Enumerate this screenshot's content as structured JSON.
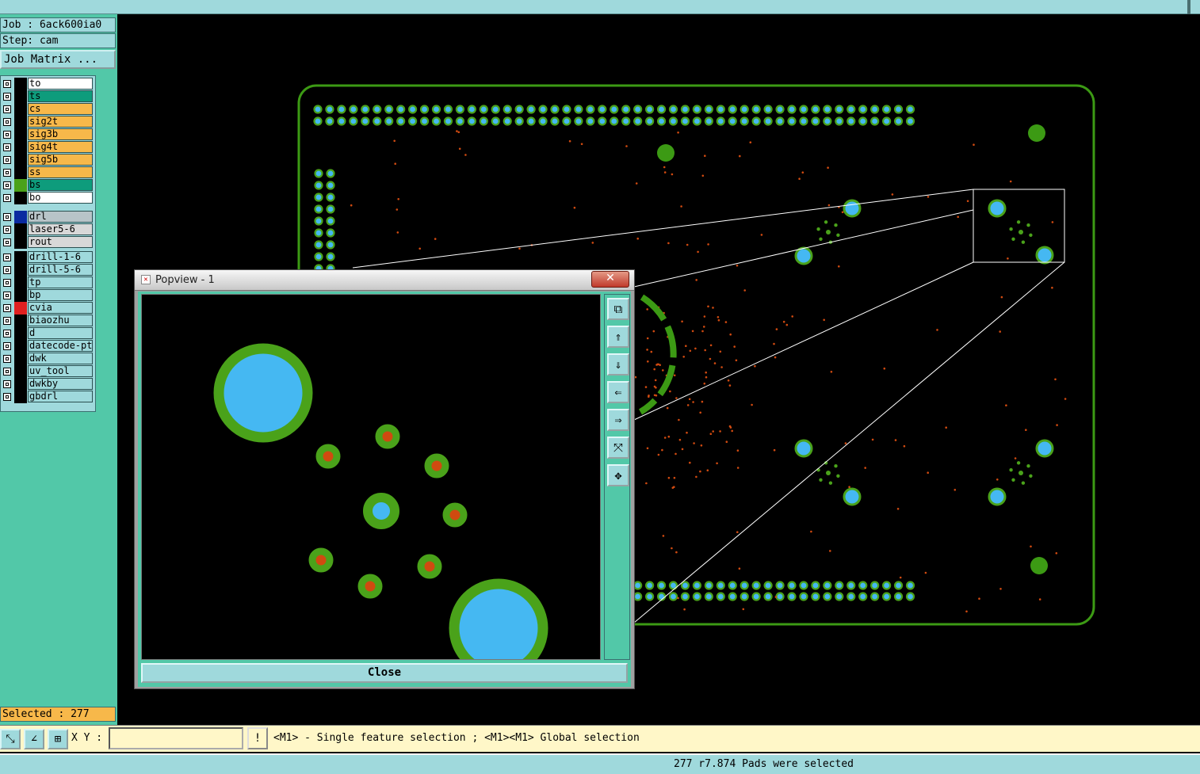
{
  "header": {
    "job": "Job : 6ack600ia0",
    "step": "Step: cam",
    "job_matrix_label": "Job Matrix ..."
  },
  "layers_group1": [
    {
      "name": "to",
      "color": "#ffffff",
      "swatch": "#000000"
    },
    {
      "name": "ts",
      "color": "#0e9c7c",
      "swatch": "#000000"
    },
    {
      "name": "cs",
      "color": "#f7b84a",
      "swatch": "#000000"
    },
    {
      "name": "sig2t",
      "color": "#f7b84a",
      "swatch": "#000000"
    },
    {
      "name": "sig3b",
      "color": "#f7b84a",
      "swatch": "#000000"
    },
    {
      "name": "sig4t",
      "color": "#f7b84a",
      "swatch": "#000000"
    },
    {
      "name": "sig5b",
      "color": "#f7b84a",
      "swatch": "#000000"
    },
    {
      "name": "ss",
      "color": "#f7b84a",
      "swatch": "#000000"
    },
    {
      "name": "bs",
      "color": "#0e9c7c",
      "swatch": "#4aa21a"
    },
    {
      "name": "bo",
      "color": "#ffffff",
      "swatch": "#000000"
    }
  ],
  "layers_group2": [
    {
      "name": "drl",
      "color": "#b8c4c8",
      "swatch": "#0a2aa0"
    },
    {
      "name": "laser5-6",
      "color": "#d8d8d8",
      "swatch": "#000000"
    },
    {
      "name": "rout",
      "color": "#d8d8d8",
      "swatch": "#000000"
    }
  ],
  "layers_group3": [
    {
      "name": "drill-1-6",
      "color": "#9fd9dc",
      "swatch": "#000000"
    },
    {
      "name": "drill-5-6",
      "color": "#9fd9dc",
      "swatch": "#000000"
    },
    {
      "name": "tp",
      "color": "#9fd9dc",
      "swatch": "#000000"
    },
    {
      "name": "bp",
      "color": "#9fd9dc",
      "swatch": "#000000"
    },
    {
      "name": "cvia",
      "color": "#9fd9dc",
      "swatch": "#e02020"
    },
    {
      "name": "biaozhu",
      "color": "#9fd9dc",
      "swatch": "#000000"
    },
    {
      "name": "d",
      "color": "#9fd9dc",
      "swatch": "#000000"
    },
    {
      "name": "datecode-ptd",
      "color": "#9fd9dc",
      "swatch": "#000000"
    },
    {
      "name": "dwk",
      "color": "#9fd9dc",
      "swatch": "#000000"
    },
    {
      "name": "uv_tool",
      "color": "#9fd9dc",
      "swatch": "#000000"
    },
    {
      "name": "dwkby",
      "color": "#9fd9dc",
      "swatch": "#000000"
    },
    {
      "name": "gbdrl",
      "color": "#9fd9dc",
      "swatch": "#000000"
    }
  ],
  "selected_label": "Selected : 277",
  "xy_label": "X Y :",
  "hint_text": "<M1> - Single feature selection ; <M1><M1> Global selection",
  "status_message": "277 r7.874 Pads were selected",
  "popview": {
    "title": "Popview - 1",
    "close_label": "Close",
    "side_icons": [
      "zoom-fit-icon",
      "pan-up-icon",
      "pan-down-icon",
      "pan-left-icon",
      "pan-right-icon",
      "zoom-out-icon",
      "zoom-in-icon"
    ]
  },
  "colors": {
    "board_outline": "#3c9a14",
    "pad_fill": "#45b8f2",
    "pad_ring": "#4aa21a",
    "via_fill": "#d04a10",
    "ui_teal": "#9fd9dc",
    "ui_green": "#52c8a8",
    "ui_orange": "#f7b84a"
  }
}
